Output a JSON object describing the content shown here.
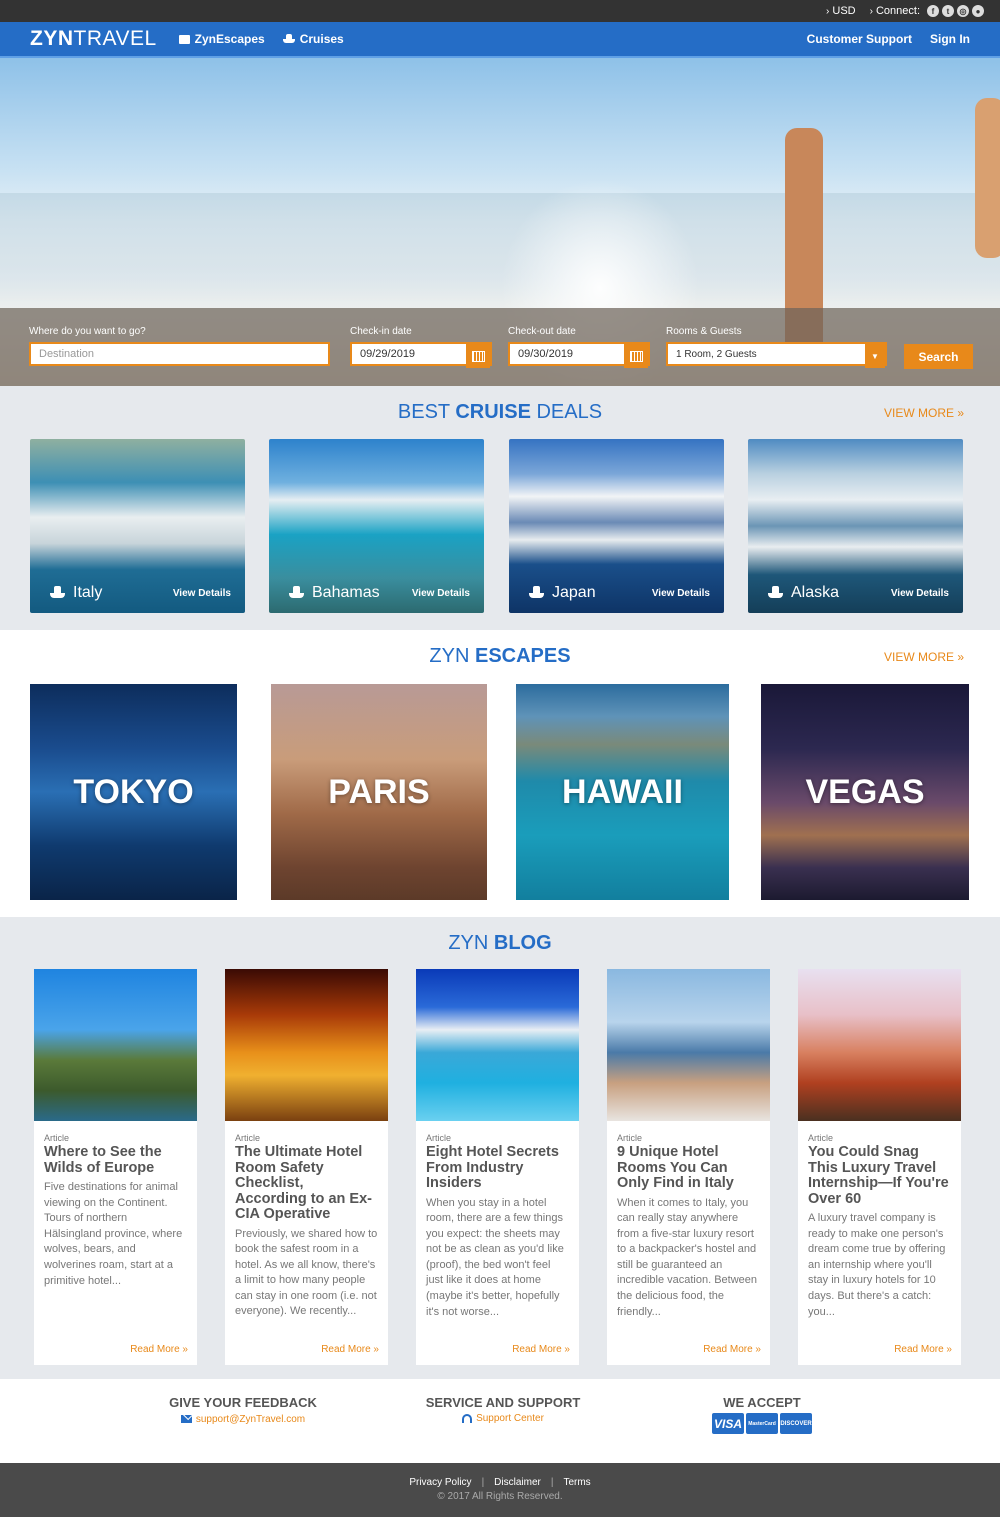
{
  "topbar": {
    "currency": "USD",
    "connect_label": "Connect:",
    "social": [
      {
        "icon": "facebook-icon",
        "glyph": "f"
      },
      {
        "icon": "twitter-icon",
        "glyph": "t"
      },
      {
        "icon": "instagram-icon",
        "glyph": "◎"
      },
      {
        "icon": "location-icon",
        "glyph": "●"
      }
    ]
  },
  "nav": {
    "logo_bold": "ZYN",
    "logo_light": "TRAVEL",
    "links": [
      {
        "label": "ZynEscapes",
        "icon": "briefcase-icon"
      },
      {
        "label": "Cruises",
        "icon": "ship-icon"
      }
    ],
    "right_links": [
      "Customer Support",
      "Sign In"
    ]
  },
  "search": {
    "destination_label": "Where do you want to go?",
    "destination_placeholder": "Destination",
    "checkin_label": "Check-in date",
    "checkin_value": "09/29/2019",
    "checkout_label": "Check-out date",
    "checkout_value": "09/30/2019",
    "rooms_label": "Rooms & Guests",
    "rooms_value": "1 Room, 2 Guests",
    "search_button": "Search"
  },
  "cruise": {
    "title_pre": "BEST ",
    "title_bold": "CRUISE",
    "title_post": " DEALS",
    "view_more": "VIEW MORE »",
    "cards": [
      {
        "name": "Italy",
        "action": "View Details"
      },
      {
        "name": "Bahamas",
        "action": "View Details"
      },
      {
        "name": "Japan",
        "action": "View Details"
      },
      {
        "name": "Alaska",
        "action": "View Details"
      }
    ]
  },
  "escapes": {
    "title_pre": "ZYN ",
    "title_bold": "ESCAPES",
    "view_more": "VIEW MORE »",
    "cards": [
      "TOKYO",
      "PARIS",
      "HAWAII",
      "VEGAS"
    ]
  },
  "blog": {
    "title_pre": "ZYN ",
    "title_bold": "BLOG",
    "posts": [
      {
        "type": "Article",
        "title": "Where to See the Wilds of Europe",
        "excerpt": "Five destinations for animal viewing on the Continent. Tours of northern Hälsingland province, where wolves, bears, and wolverines roam, start at a primitive hotel...",
        "more": "Read More »"
      },
      {
        "type": "Article",
        "title": "The Ultimate Hotel Room Safety Checklist, According to an Ex-CIA Operative",
        "excerpt": "Previously, we shared how to book the safest room in a hotel. As we all know, there's a limit to how many people can stay in one room (i.e. not everyone). We recently...",
        "more": "Read More »"
      },
      {
        "type": "Article",
        "title": "Eight Hotel Secrets From Industry Insiders",
        "excerpt": "When you stay in a hotel room, there are a few things you expect: the sheets may not be as clean as you'd like (proof), the bed won't feel just like it does at home (maybe it's better, hopefully it's not worse...",
        "more": "Read More »"
      },
      {
        "type": "Article",
        "title": "9 Unique Hotel Rooms You Can Only Find in Italy",
        "excerpt": "When it comes to Italy, you can really stay anywhere from a five-star luxury resort to a backpacker's hostel and still be guaranteed an incredible vacation. Between the delicious food, the friendly...",
        "more": "Read More »"
      },
      {
        "type": "Article",
        "title": "You Could Snag This Luxury Travel Internship—If You're Over 60",
        "excerpt": "A luxury travel company is ready to make one person's dream come true by offering an internship where you'll stay in luxury hotels for 10 days. But there's a catch: you...",
        "more": "Read More »"
      }
    ]
  },
  "footer": {
    "feedback_title": "GIVE YOUR FEEDBACK",
    "feedback_email": "support@ZynTravel.com",
    "support_title": "SERVICE AND SUPPORT",
    "support_link": "Support Center",
    "accept_title": "WE ACCEPT",
    "cards": [
      "VISA",
      "MasterCard",
      "DISCOVER"
    ],
    "links": [
      "Privacy Policy",
      "Disclaimer",
      "Terms"
    ],
    "separator": "|",
    "copyright": "© 2017 All Rights Reserved."
  },
  "colors": {
    "brand_blue": "#256dc6",
    "accent_orange": "#e8891a",
    "topbar": "#333333",
    "footer": "#4a4a4a"
  }
}
